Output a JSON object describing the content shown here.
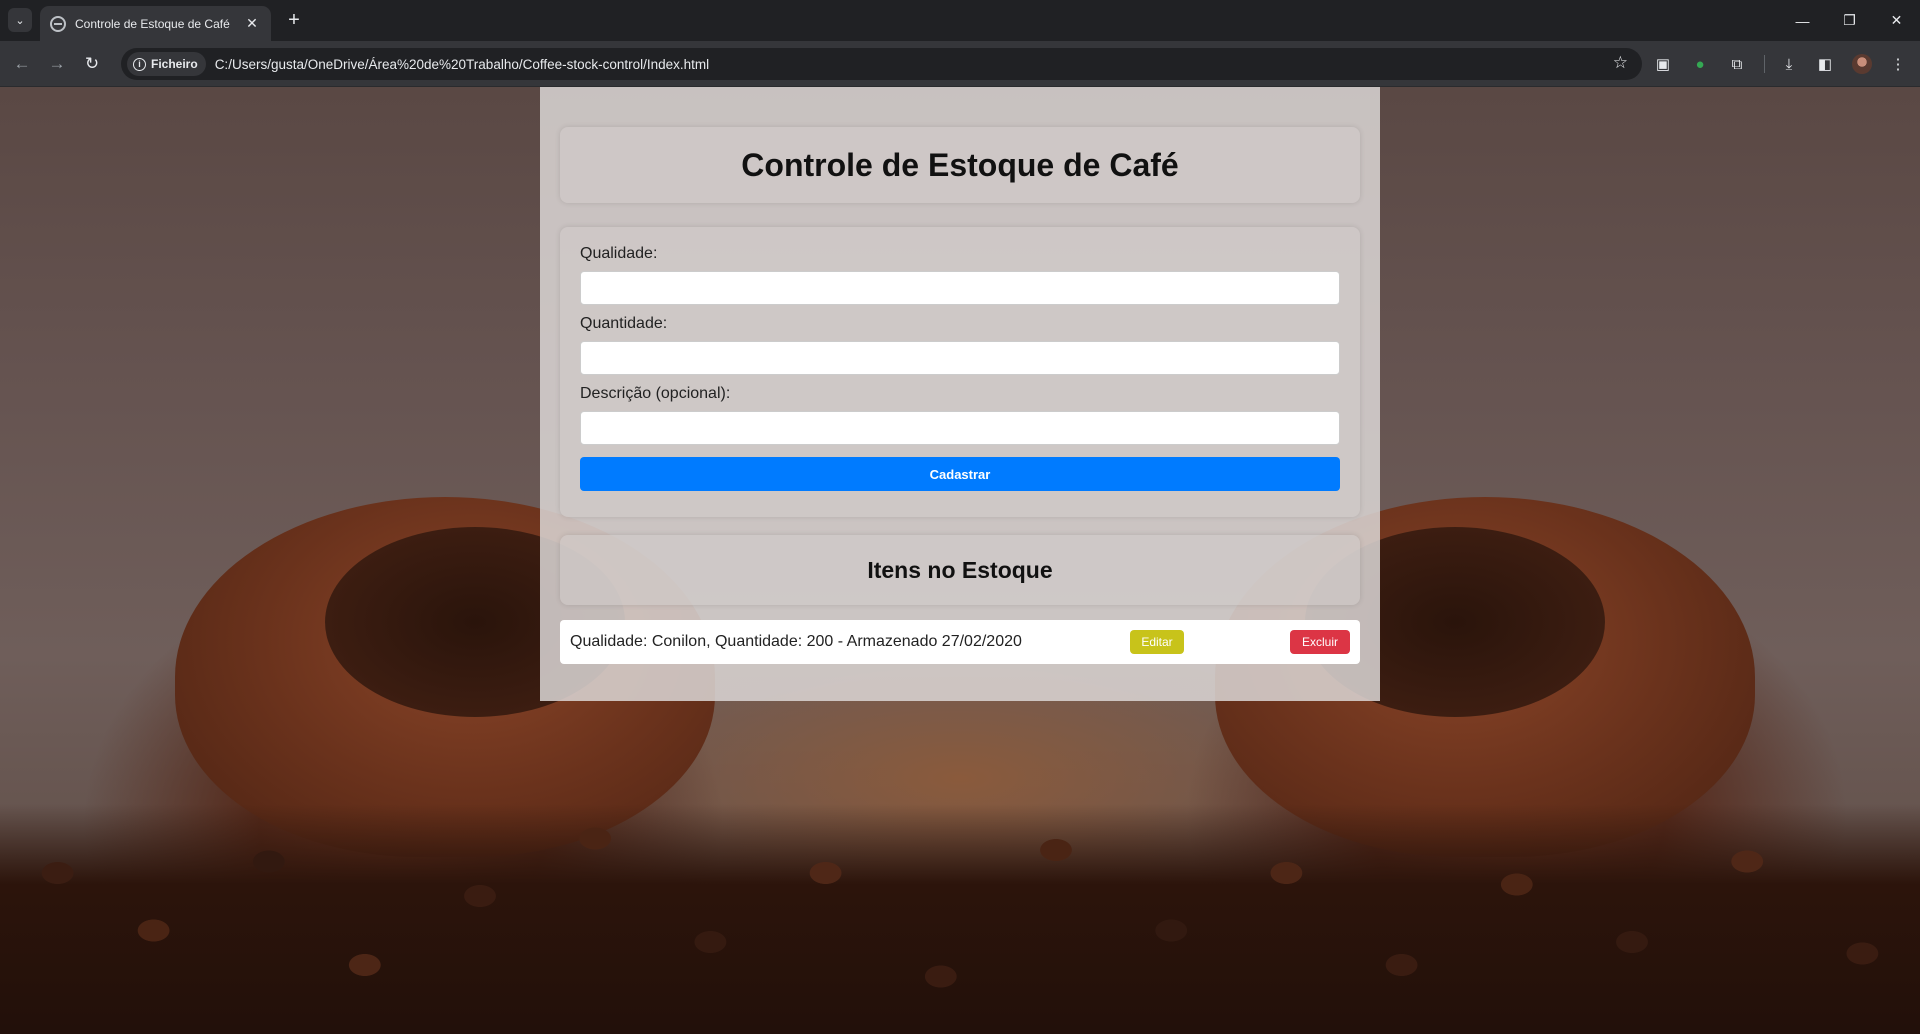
{
  "browser": {
    "tab_title": "Controle de Estoque de Café",
    "tab_close": "✕",
    "new_tab": "+",
    "chip_label": "Ficheiro",
    "url": "C:/Users/gusta/OneDrive/Área%20de%20Trabalho/Coffee-stock-control/Index.html",
    "icons": [
      "back-icon",
      "forward-icon",
      "reload-icon",
      "info-icon",
      "star-icon",
      "extension-icon",
      "download-icon",
      "side-panel-icon",
      "avatar",
      "menu-icon"
    ]
  },
  "app": {
    "title": "Controle de Estoque de Café",
    "form": {
      "quality_label": "Qualidade:",
      "quality_value": "",
      "quantity_label": "Quantidade:",
      "quantity_value": "",
      "description_label": "Descrição (opcional):",
      "description_value": "",
      "submit_label": "Cadastrar"
    },
    "list_title": "Itens no Estoque",
    "items": [
      {
        "text": "Qualidade: Conilon, Quantidade: 200 - Armazenado 27/02/2020",
        "edit_label": "Editar",
        "delete_label": "Excluir"
      }
    ]
  },
  "colors": {
    "primary": "#007bff",
    "edit": "#c8c31a",
    "delete": "#dc3545"
  }
}
